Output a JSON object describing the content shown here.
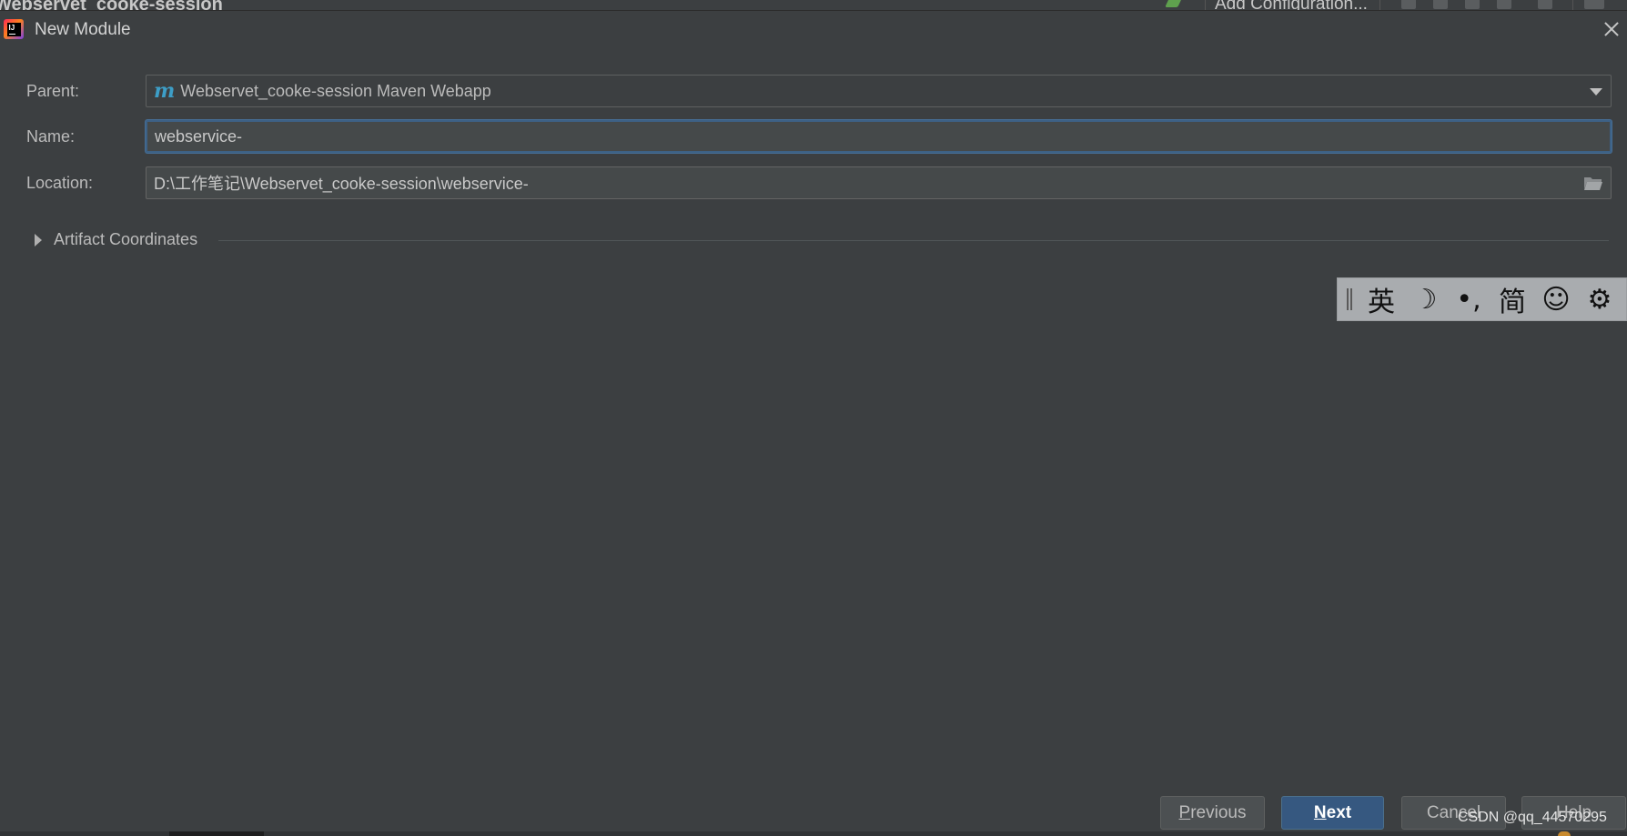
{
  "background_ide": {
    "project_title": "Webservet_cooke-session",
    "run_config_label": "Add Configuration..."
  },
  "dialog": {
    "title": "New Module",
    "app_icon": "intellij-idea-icon",
    "close_icon": "close-icon"
  },
  "form": {
    "parent": {
      "label": "Parent:",
      "value": "Webservet_cooke-session Maven Webapp",
      "icon_letter": "m",
      "icon": "maven-icon"
    },
    "name": {
      "label": "Name:",
      "value": "webservice-"
    },
    "location": {
      "label": "Location:",
      "value": "D:\\工作笔记\\Webservet_cooke-session\\webservice-",
      "icon": "folder-icon"
    }
  },
  "artifact_section": {
    "label": "Artifact Coordinates",
    "expanded": false
  },
  "ime_toolbar": {
    "items": [
      "英",
      "☽",
      "•,",
      "简",
      "☺",
      "⚙"
    ]
  },
  "buttons": {
    "previous_mnemonic": "P",
    "previous_rest": "revious",
    "next_mnemonic": "N",
    "next_rest": "ext",
    "cancel": "Cancel",
    "help": "Help"
  },
  "watermark": "CSDN @qq_44570295",
  "colors": {
    "dialog_bg": "#3c3f41",
    "field_bg": "#45494a",
    "focus_border": "#3d6185",
    "primary_button": "#365880",
    "maven_icon": "#3d9ec7"
  }
}
